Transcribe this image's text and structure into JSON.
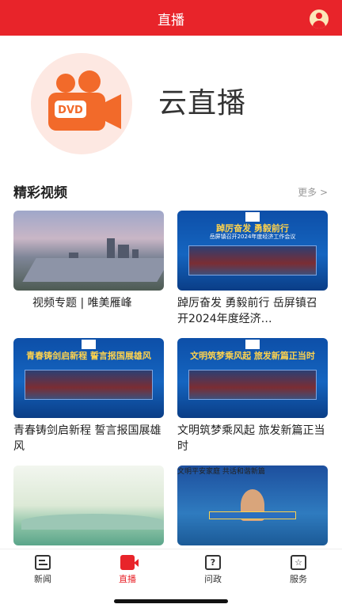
{
  "header": {
    "title": "直播",
    "user_icon": "user-avatar-icon"
  },
  "hero": {
    "logo_icon": "dvd-camera-icon",
    "logo_label": "DVD",
    "title": "云直播"
  },
  "section": {
    "title": "精彩视频",
    "more": "更多 >"
  },
  "videos": [
    {
      "caption": "视频专题 | 唯美雁峰",
      "thumb_type": "city"
    },
    {
      "caption": "踔厉奋发 勇毅前行 岳屏镇召开2024年度经济…",
      "thumb_type": "blue",
      "headline": "踔厉奋发 勇毅前行",
      "subline": "岳屏镇召开2024年度经济工作会议"
    },
    {
      "caption": "青春铸剑启新程 誓言报国展雄风",
      "thumb_type": "blue",
      "headline": "青春铸剑启新程 誓言报国展雄风"
    },
    {
      "caption": "文明筑梦乘风起 旅发新篇正当时",
      "thumb_type": "blue",
      "headline": "文明筑梦乘风起 旅发新篇正当时"
    },
    {
      "caption": "",
      "thumb_type": "nature"
    },
    {
      "caption": "",
      "thumb_type": "video",
      "headline": "文明平安家庭 共话和谐新篇"
    }
  ],
  "tabs": [
    {
      "label": "新闻",
      "icon": "news-icon"
    },
    {
      "label": "直播",
      "icon": "live-camera-icon",
      "active": true
    },
    {
      "label": "问政",
      "icon": "question-icon"
    },
    {
      "label": "服务",
      "icon": "service-star-icon"
    }
  ],
  "colors": {
    "brand_red": "#e8242a",
    "text": "#222222",
    "muted": "#999999"
  }
}
